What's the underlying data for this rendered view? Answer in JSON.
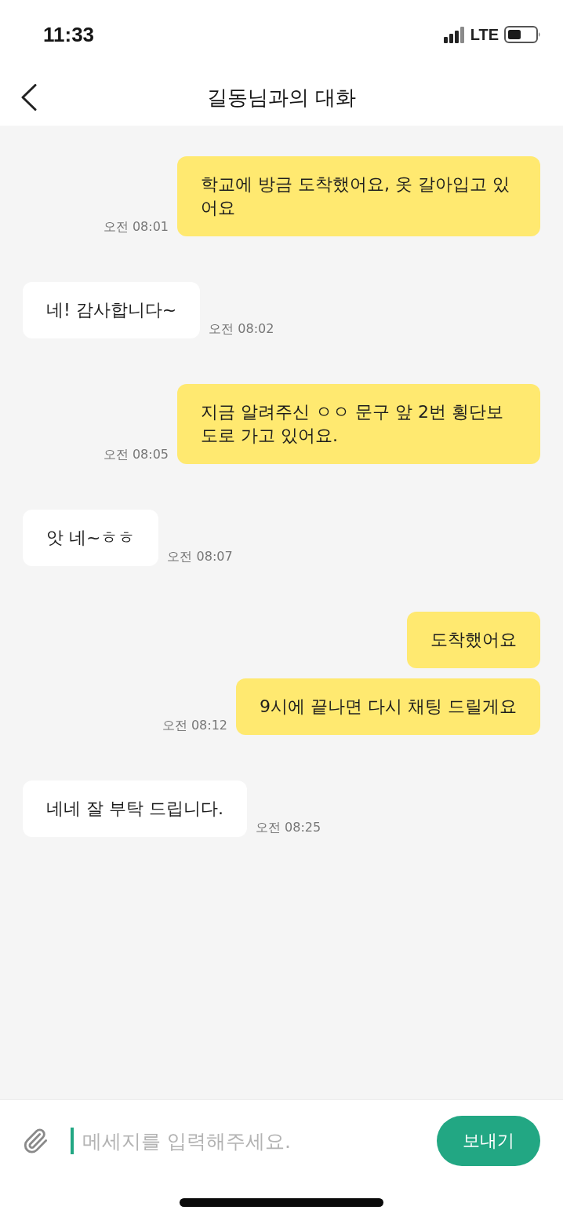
{
  "status_bar": {
    "time": "11:33",
    "network": "LTE"
  },
  "header": {
    "title": "길동님과의 대화"
  },
  "messages": [
    {
      "kind": "sent",
      "text": "학교에 방금 도착했어요, 옷 갈아입고 있어요",
      "time": "오전 08:01"
    },
    {
      "kind": "received",
      "text": "네! 감사합니다~",
      "time": "오전 08:02"
    },
    {
      "kind": "sent",
      "text": "지금 알려주신 ㅇㅇ 문구 앞 2번 횡단보도로 가고 있어요.",
      "time": "오전 08:05"
    },
    {
      "kind": "received",
      "text": "앗 네~ㅎㅎ",
      "time": "오전 08:07"
    },
    {
      "kind": "sent",
      "text": "도착했어요"
    },
    {
      "kind": "sent",
      "text": "9시에 끝나면 다시 채팅 드릴게요",
      "time": "오전 08:12"
    },
    {
      "kind": "received",
      "text": "네네 잘 부탁 드립니다.",
      "time": "오전 08:25"
    }
  ],
  "composer": {
    "placeholder": "메세지를 입력해주세요.",
    "send_button": "보내기"
  }
}
